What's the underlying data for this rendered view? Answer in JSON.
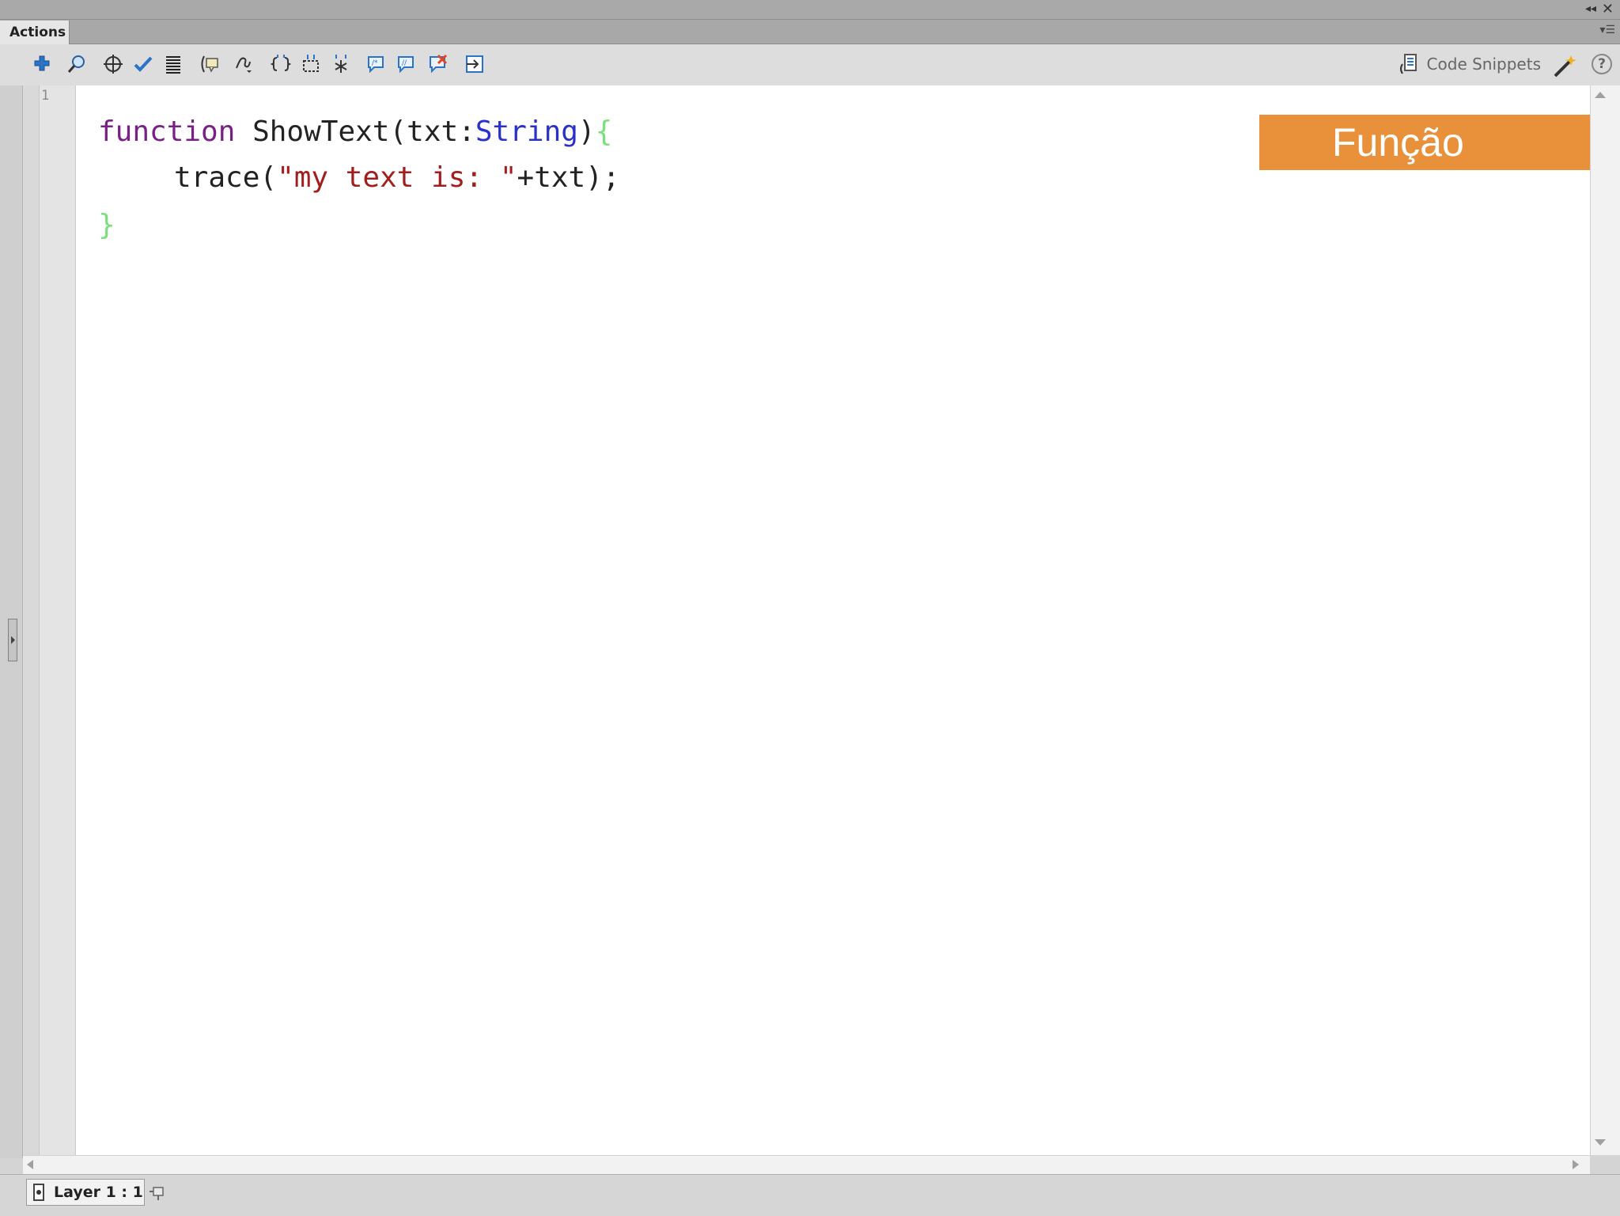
{
  "panel": {
    "tab_label": "Actions"
  },
  "toolbar": {
    "buttons": [
      "add-new-item-icon",
      "find-icon",
      "insert-target-path-icon",
      "check-syntax-icon",
      "auto-format-icon",
      "show-code-hint-icon",
      "debug-options-icon",
      "collapse-between-braces-icon",
      "collapse-selection-icon",
      "expand-all-icon",
      "apply-block-comment-icon",
      "apply-line-comment-icon",
      "remove-comment-icon",
      "show-hide-toolbox-icon"
    ],
    "code_snippets_label": "Code Snippets"
  },
  "editor": {
    "line_number": "1",
    "code": {
      "line1": {
        "keyword": "function",
        "name": "ShowText",
        "paren_open": "(",
        "param": "txt",
        "colon": ":",
        "type": "String",
        "paren_close": ")",
        "brace_open": "{"
      },
      "line2": {
        "call": "trace",
        "paren_open": "(",
        "string": "\"my text is: \"",
        "plus": "+",
        "arg": "txt",
        "end": ");"
      },
      "line3": {
        "brace_close": "}"
      }
    },
    "colors": {
      "keyword": "#7a1f86",
      "type": "#2a31c9",
      "string": "#a11e1e",
      "brace": "#7be07b",
      "text": "#222222"
    }
  },
  "overlay": {
    "label": "Função",
    "color": "#e8913a"
  },
  "status": {
    "layer_label": "Layer 1 : 1"
  }
}
